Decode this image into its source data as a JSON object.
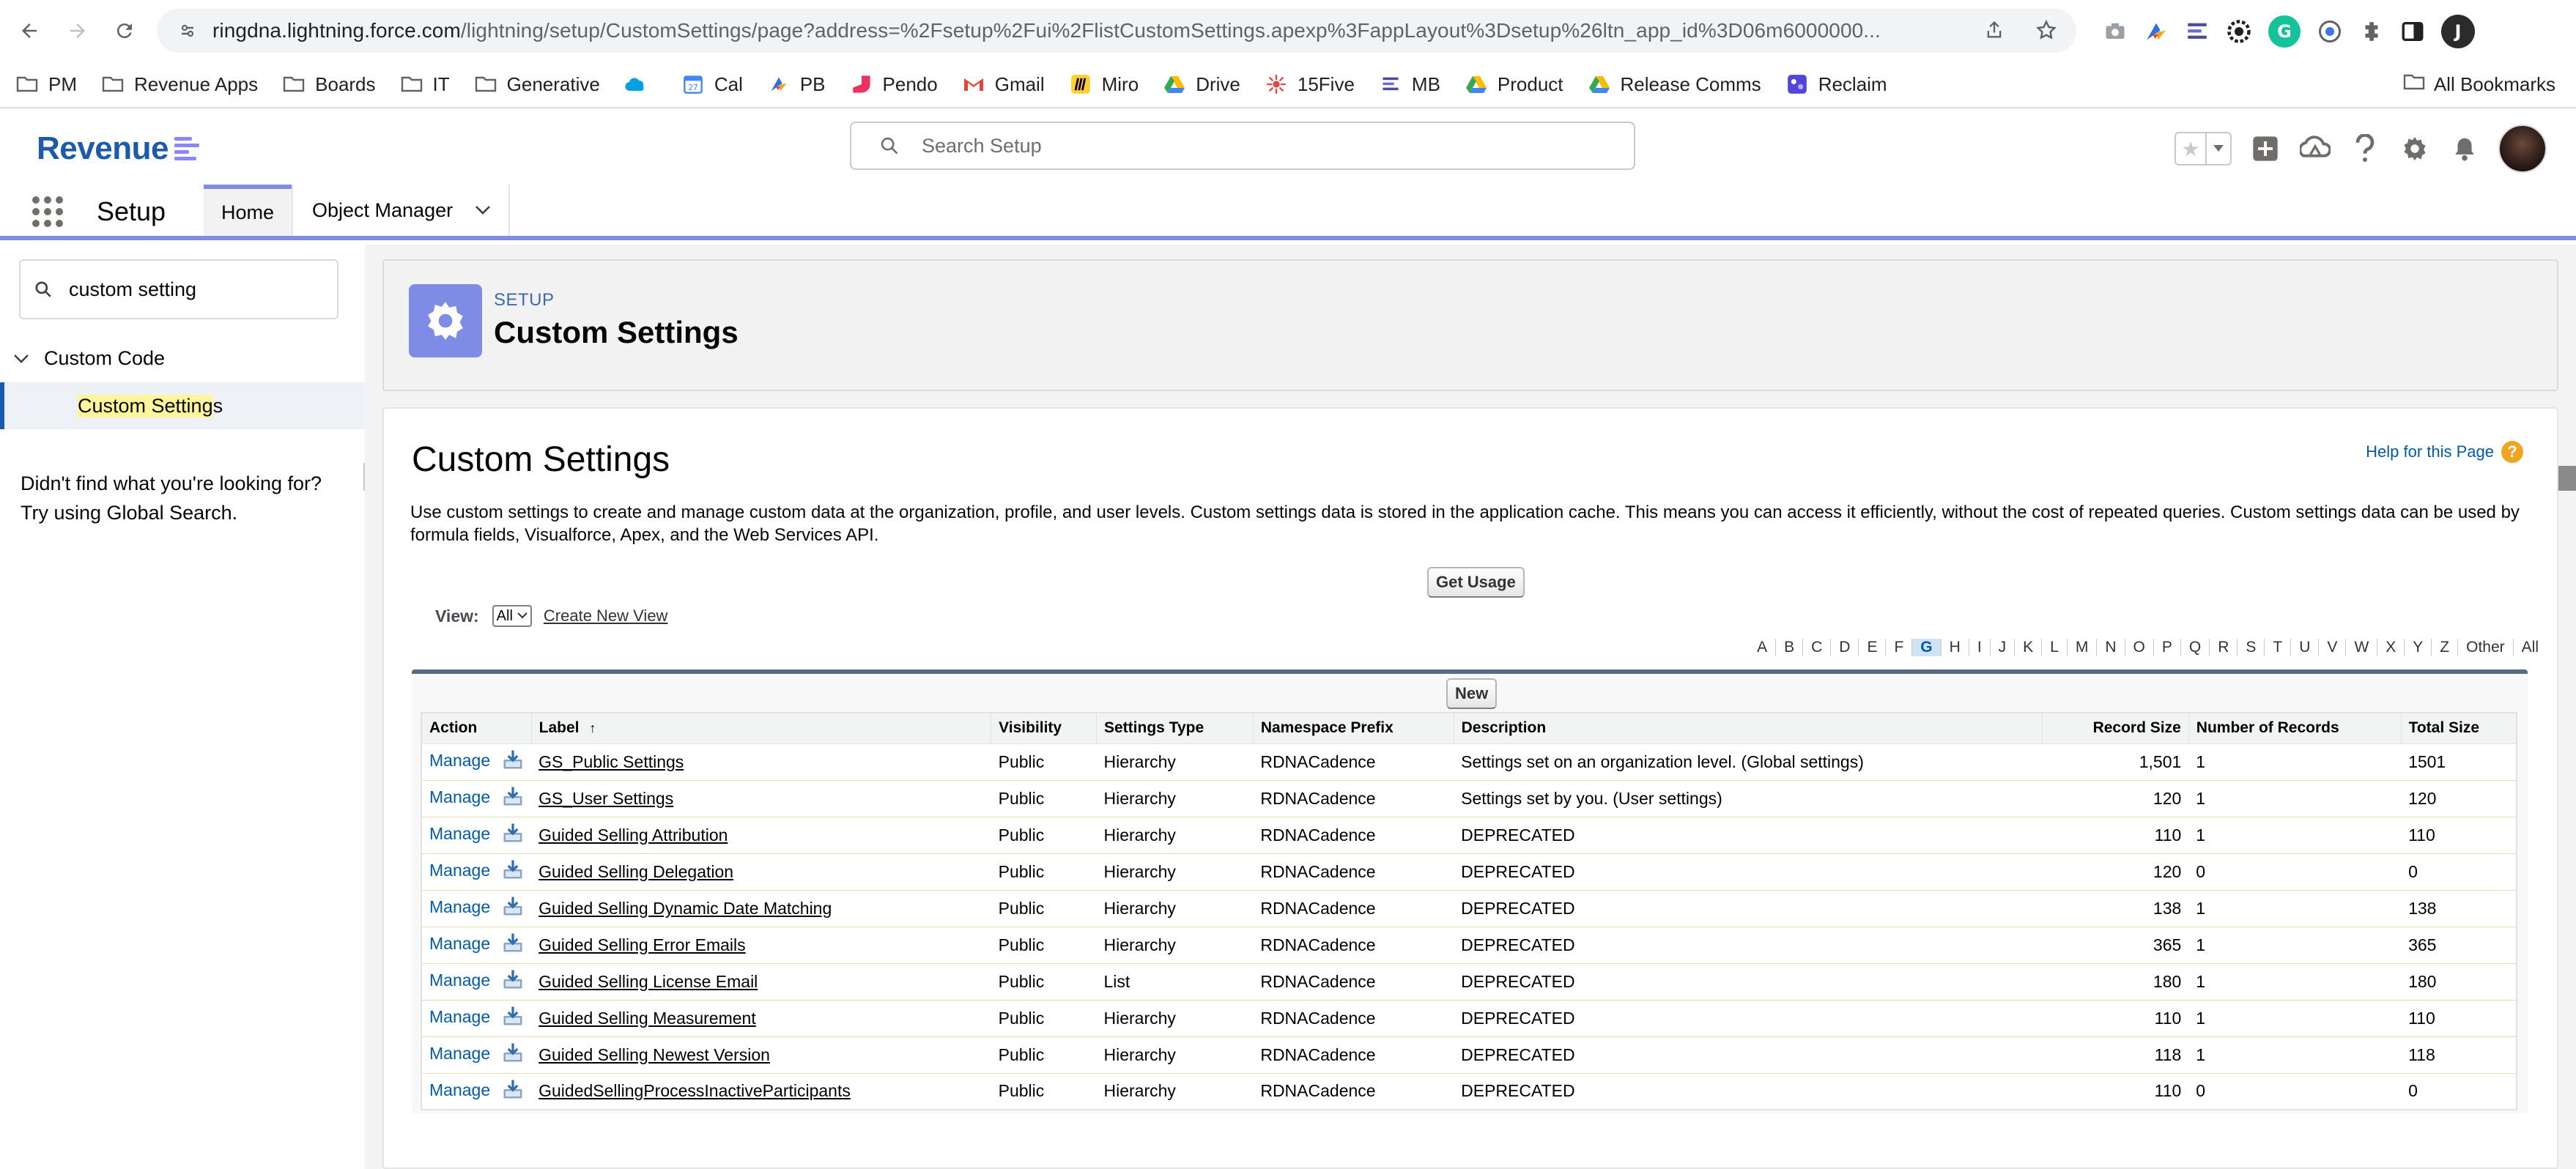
{
  "browser": {
    "url_host": "ringdna.lightning.force.com",
    "url_path": "/lightning/setup/CustomSettings/page?address=%2Fsetup%2Fui%2FlistCustomSettings.apexp%3FappLayout%3Dsetup%26ltn_app_id%3D06m6000000...",
    "extension_initial": "J",
    "bookmarks": [
      {
        "label": "PM",
        "icon": "folder-icon"
      },
      {
        "label": "Revenue Apps",
        "icon": "folder-icon"
      },
      {
        "label": "Boards",
        "icon": "folder-icon"
      },
      {
        "label": "IT",
        "icon": "folder-icon"
      },
      {
        "label": "Generative",
        "icon": "folder-icon"
      },
      {
        "label": "",
        "icon": "salesforce-cloud-icon"
      },
      {
        "label": "Cal",
        "icon": "calendar-icon"
      },
      {
        "label": "PB",
        "icon": "pb-icon"
      },
      {
        "label": "Pendo",
        "icon": "pendo-icon"
      },
      {
        "label": "Gmail",
        "icon": "gmail-icon"
      },
      {
        "label": "Miro",
        "icon": "miro-icon"
      },
      {
        "label": "Drive",
        "icon": "drive-icon"
      },
      {
        "label": "15Five",
        "icon": "15five-icon"
      },
      {
        "label": "MB",
        "icon": "mb-icon"
      },
      {
        "label": "Product",
        "icon": "drive-icon"
      },
      {
        "label": "Release Comms",
        "icon": "drive-icon"
      },
      {
        "label": "Reclaim",
        "icon": "reclaim-icon"
      }
    ],
    "all_bookmarks": "All Bookmarks"
  },
  "header": {
    "brand": "Revenue",
    "search_placeholder": "Search Setup"
  },
  "app_nav": {
    "app_name": "Setup",
    "tabs": [
      {
        "label": "Home"
      },
      {
        "label": "Object Manager"
      }
    ]
  },
  "sidebar": {
    "quick_find_value": "custom setting",
    "group": "Custom Code",
    "item_highlight": "Custom Setting",
    "item_rest": "s",
    "not_found_line1": "Didn't find what you're looking for?",
    "not_found_line2": "Try using Global Search."
  },
  "page_header": {
    "kicker": "SETUP",
    "title": "Custom Settings"
  },
  "content": {
    "title": "Custom Settings",
    "help_link": "Help for this Page",
    "description": "Use custom settings to create and manage custom data at the organization, profile, and user levels. Custom settings data is stored in the application cache. This means you can access it efficiently, without the cost of repeated queries. Custom settings data can be used by formula fields, Visualforce, Apex, and the Web Services API.",
    "get_usage": "Get Usage",
    "view_label": "View:",
    "view_value": "All",
    "create_view": "Create New View",
    "new_button": "New",
    "alpha": [
      "A",
      "B",
      "C",
      "D",
      "E",
      "F",
      "G",
      "H",
      "I",
      "J",
      "K",
      "L",
      "M",
      "N",
      "O",
      "P",
      "Q",
      "R",
      "S",
      "T",
      "U",
      "V",
      "W",
      "X",
      "Y",
      "Z",
      "Other",
      "All"
    ],
    "alpha_selected": "G",
    "columns": {
      "action": "Action",
      "label": "Label",
      "sort_arrow": "↑",
      "visibility": "Visibility",
      "settings_type": "Settings Type",
      "namespace": "Namespace Prefix",
      "description": "Description",
      "record_size": "Record Size",
      "num_records": "Number of Records",
      "total_size": "Total Size"
    },
    "manage_label": "Manage",
    "rows": [
      {
        "label": "GS_Public Settings",
        "visibility": "Public",
        "type": "Hierarchy",
        "ns": "RDNACadence",
        "desc": "Settings set on an organization level. (Global settings)",
        "rsize": "1,501",
        "count": "1",
        "total": "1501"
      },
      {
        "label": "GS_User Settings",
        "visibility": "Public",
        "type": "Hierarchy",
        "ns": "RDNACadence",
        "desc": "Settings set by you. (User settings)",
        "rsize": "120",
        "count": "1",
        "total": "120"
      },
      {
        "label": "Guided Selling Attribution",
        "visibility": "Public",
        "type": "Hierarchy",
        "ns": "RDNACadence",
        "desc": "DEPRECATED",
        "rsize": "110",
        "count": "1",
        "total": "110"
      },
      {
        "label": "Guided Selling Delegation",
        "visibility": "Public",
        "type": "Hierarchy",
        "ns": "RDNACadence",
        "desc": "DEPRECATED",
        "rsize": "120",
        "count": "0",
        "total": "0"
      },
      {
        "label": "Guided Selling Dynamic Date Matching",
        "visibility": "Public",
        "type": "Hierarchy",
        "ns": "RDNACadence",
        "desc": "DEPRECATED",
        "rsize": "138",
        "count": "1",
        "total": "138"
      },
      {
        "label": "Guided Selling Error Emails",
        "visibility": "Public",
        "type": "Hierarchy",
        "ns": "RDNACadence",
        "desc": "DEPRECATED",
        "rsize": "365",
        "count": "1",
        "total": "365"
      },
      {
        "label": "Guided Selling License Email",
        "visibility": "Public",
        "type": "List",
        "ns": "RDNACadence",
        "desc": "DEPRECATED",
        "rsize": "180",
        "count": "1",
        "total": "180"
      },
      {
        "label": "Guided Selling Measurement",
        "visibility": "Public",
        "type": "Hierarchy",
        "ns": "RDNACadence",
        "desc": "DEPRECATED",
        "rsize": "110",
        "count": "1",
        "total": "110"
      },
      {
        "label": "Guided Selling Newest Version",
        "visibility": "Public",
        "type": "Hierarchy",
        "ns": "RDNACadence",
        "desc": "DEPRECATED",
        "rsize": "118",
        "count": "1",
        "total": "118"
      },
      {
        "label": "GuidedSellingProcessInactiveParticipants",
        "visibility": "Public",
        "type": "Hierarchy",
        "ns": "RDNACadence",
        "desc": "DEPRECATED",
        "rsize": "110",
        "count": "0",
        "total": "0"
      }
    ]
  },
  "colors": {
    "brand_blue": "#1b5aad",
    "setup_icon_bg": "#7f8ce5",
    "link_blue": "#015ba7",
    "nav_accent": "#7f8de1"
  }
}
